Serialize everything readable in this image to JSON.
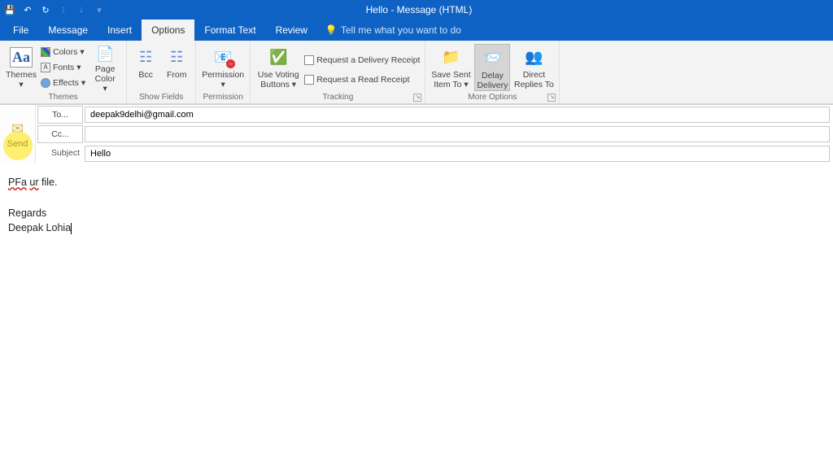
{
  "titlebar": {
    "title": "Hello  -  Message (HTML)"
  },
  "tabs": {
    "file": "File",
    "message": "Message",
    "insert": "Insert",
    "options": "Options",
    "format": "Format Text",
    "review": "Review",
    "tell": "Tell me what you want to do"
  },
  "ribbon": {
    "themes": {
      "label": "Themes",
      "themes_btn": "Themes",
      "colors": "Colors",
      "fonts": "Fonts",
      "effects": "Effects",
      "pagecolor": "Page Color"
    },
    "showfields": {
      "label": "Show Fields",
      "bcc": "Bcc",
      "from": "From"
    },
    "permission": {
      "label": "Permission",
      "btn": "Permission"
    },
    "tracking": {
      "label": "Tracking",
      "voting": "Use Voting Buttons",
      "delivery": "Request a Delivery Receipt",
      "read": "Request a Read Receipt"
    },
    "moreoptions": {
      "label": "More Options",
      "savesent": "Save Sent Item To",
      "delay": "Delay Delivery",
      "direct": "Direct Replies To"
    }
  },
  "compose": {
    "send": "Send",
    "to_label": "To...",
    "cc_label": "Cc...",
    "subject_label": "Subject",
    "to_value": "deepak9delhi@gmail.com",
    "cc_value": "",
    "subject_value": "Hello"
  },
  "body": {
    "line1a": "PFa",
    "line1b": "ur",
    "line1c": " file.",
    "line2": "Regards",
    "line3": "Deepak Lohia"
  }
}
